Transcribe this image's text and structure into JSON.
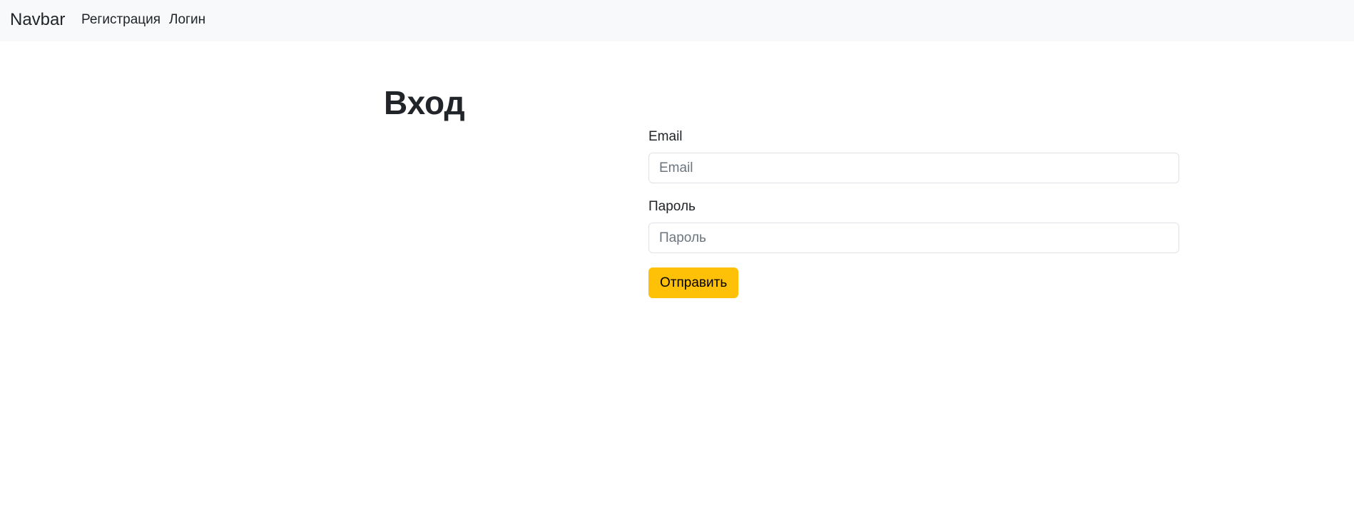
{
  "navbar": {
    "brand": "Navbar",
    "links": [
      {
        "label": "Регистрация"
      },
      {
        "label": "Логин"
      }
    ]
  },
  "page": {
    "title": "Вход"
  },
  "form": {
    "email": {
      "label": "Email",
      "placeholder": "Email",
      "value": ""
    },
    "password": {
      "label": "Пароль",
      "placeholder": "Пароль",
      "value": ""
    },
    "submit_label": "Отправить"
  },
  "colors": {
    "navbar_bg": "#f8f9fa",
    "button_bg": "#ffc107",
    "text": "#212529",
    "input_border": "#dee2e6"
  }
}
